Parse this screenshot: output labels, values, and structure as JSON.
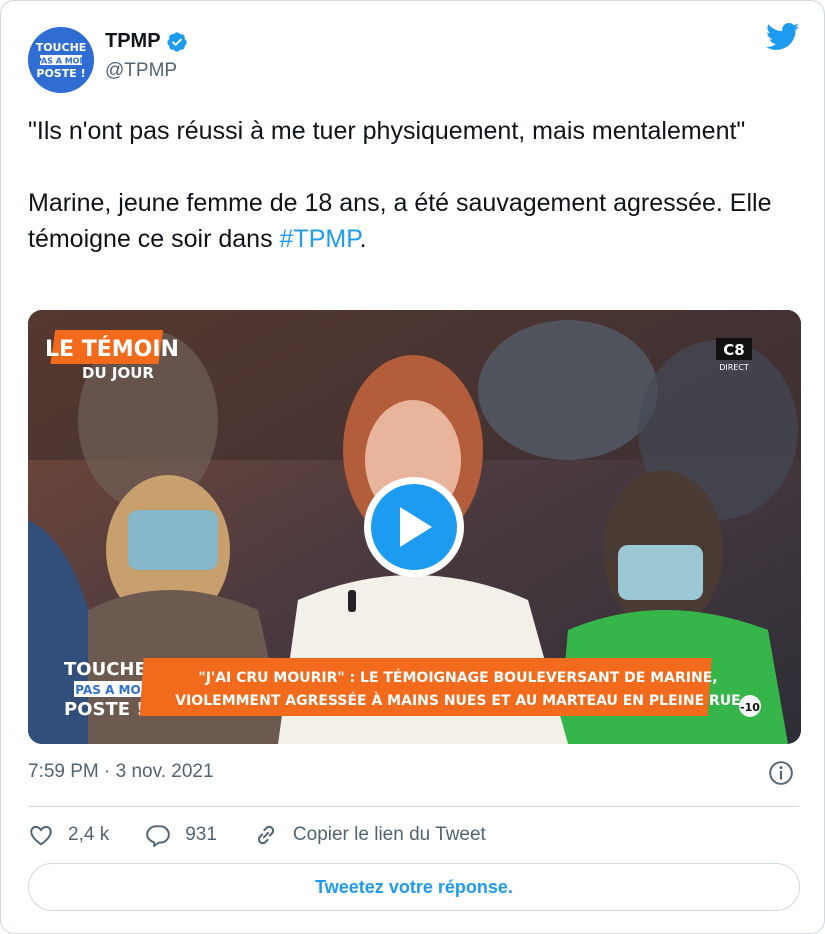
{
  "account": {
    "name": "TPMP",
    "handle": "@TPMP",
    "verified": true,
    "avatar_logo_lines": [
      "TOUCHE",
      "PAS A MON",
      "POSTE !"
    ]
  },
  "tweet": {
    "line1": "\"Ils n'ont pas réussi à me tuer physiquement, mais mentalement\"",
    "line2_prefix": "Marine, jeune femme de 18 ans, a été sauvagement agressée. Elle témoigne ce soir dans ",
    "hashtag": "#TPMP",
    "line2_suffix": "."
  },
  "media": {
    "type": "video",
    "overlay_title": "LE TÉMOIN",
    "overlay_subtitle": "DU JOUR",
    "channel_logo": "C8",
    "channel_live": "DIRECT",
    "show_logo_lines": [
      "TOUCHE",
      "PAS A MON",
      "POSTE !"
    ],
    "banner_line1": "\"J'AI CRU MOURIR\" : LE TÉMOIGNAGE BOULEVERSANT DE MARINE,",
    "banner_line2": "VIOLEMMENT AGRESSÉE À MAINS NUES ET AU MARTEAU EN PLEINE RUE",
    "rating_badge": "-10"
  },
  "meta": {
    "timestamp": "7:59 PM · 3 nov. 2021"
  },
  "actions": {
    "likes": "2,4 k",
    "replies": "931",
    "copy_link": "Copier le lien du Tweet"
  },
  "reply_button": "Tweetez votre réponse.",
  "colors": {
    "accent": "#1d9bf0",
    "text": "#0f1419",
    "muted": "#536471",
    "border": "#cfd9de",
    "banner_orange": "#f26a1b"
  }
}
